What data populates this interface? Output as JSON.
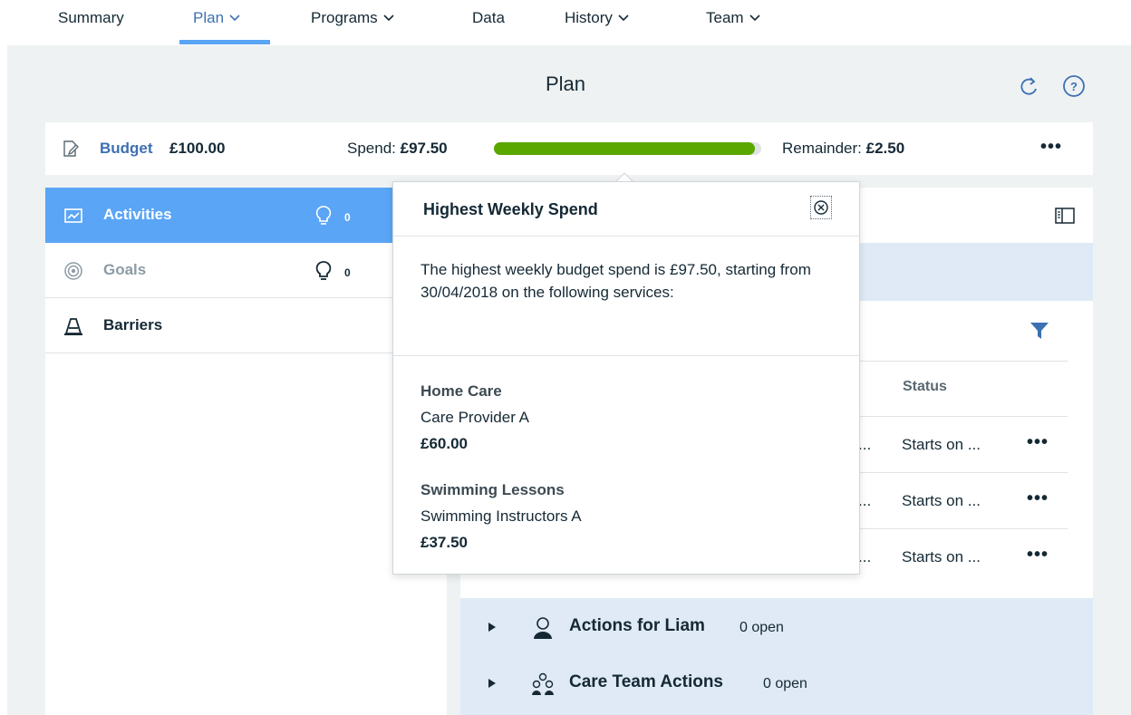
{
  "nav": {
    "tabs": [
      {
        "label": "Summary"
      },
      {
        "label": "Plan"
      },
      {
        "label": "Programs"
      },
      {
        "label": "Data"
      },
      {
        "label": "History"
      },
      {
        "label": "Team"
      }
    ],
    "active_tab": "Plan"
  },
  "page": {
    "title": "Plan",
    "icons": [
      "refresh-icon",
      "help-icon"
    ]
  },
  "budget": {
    "label": "Budget",
    "amount": "£100.00",
    "spend_label": "Spend:",
    "spend_value": "£97.50",
    "spend_fraction": 0.975,
    "remainder_label": "Remainder:",
    "remainder_value": "£2.50",
    "more": "•••"
  },
  "sidebar": {
    "items": [
      {
        "label": "Activities",
        "count": "0",
        "icon": "activities-icon",
        "state": "active"
      },
      {
        "label": "Goals",
        "count": "0",
        "icon": "target-icon",
        "state": "muted"
      },
      {
        "label": "Barriers",
        "icon": "cone-icon",
        "state": "normal"
      }
    ]
  },
  "table": {
    "status_header": "Status",
    "rows": [
      {
        "truncated": "...",
        "status": "Starts on ...",
        "more": "•••"
      },
      {
        "truncated": "...",
        "status": "Starts on ...",
        "more": "•••"
      },
      {
        "truncated": "...",
        "status": "Starts on ...",
        "more": "•••"
      }
    ]
  },
  "actions": [
    {
      "title": "Actions for Liam",
      "count": "0 open",
      "icon": "person-icon"
    },
    {
      "title": "Care Team Actions",
      "count": "0 open",
      "icon": "team-icon"
    }
  ],
  "popover": {
    "title": "Highest Weekly Spend",
    "body": "The highest weekly budget spend is £97.50, starting from 30/04/2018 on the following services:",
    "services": [
      {
        "name": "Home Care",
        "provider": "Care Provider A",
        "amount": "£60.00"
      },
      {
        "name": "Swimming Lessons",
        "provider": "Swimming Instructors A",
        "amount": "£37.50"
      }
    ]
  },
  "colors": {
    "accent": "#3d70b2",
    "active_tab_underline": "#5aa5f5",
    "active_sidebar": "#5aa5f5",
    "progress": "#5aa700",
    "background": "#eef2f2",
    "band": "#dfeaf6"
  }
}
